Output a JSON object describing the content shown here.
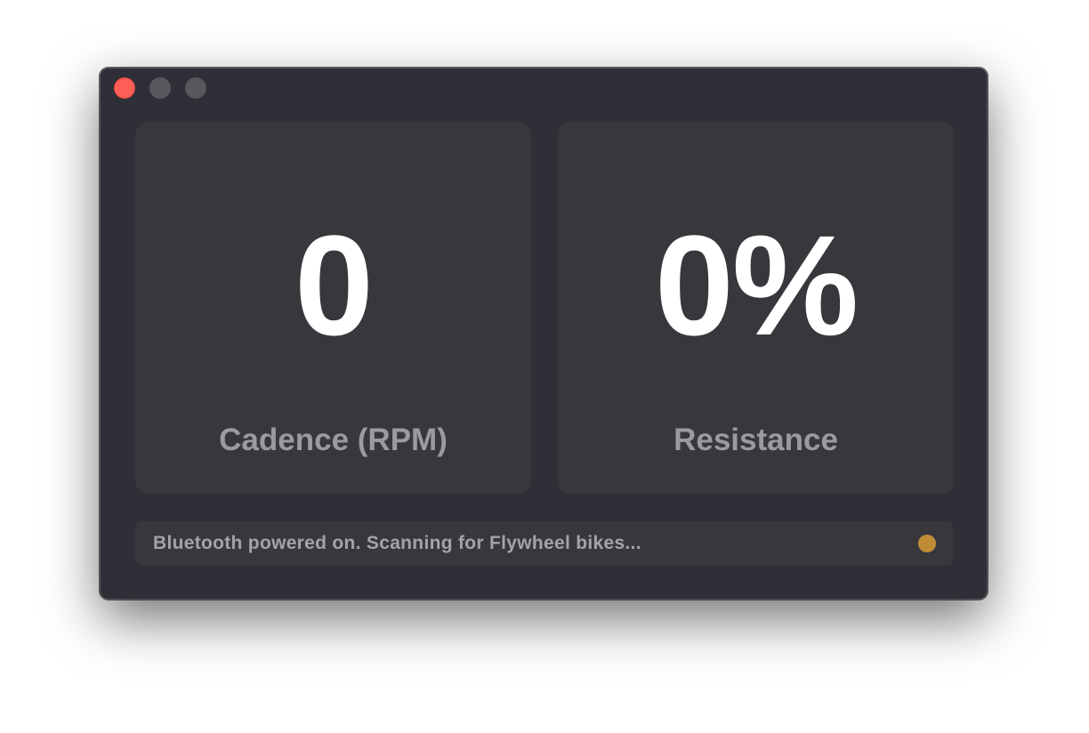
{
  "window": {
    "controls": {
      "close": "close-icon",
      "minimize": "minimize-icon",
      "zoom": "zoom-icon"
    }
  },
  "metrics": {
    "cadence": {
      "value": "0",
      "label": "Cadence (RPM)"
    },
    "resistance": {
      "value": "0%",
      "label": "Resistance"
    }
  },
  "status": {
    "message": "Bluetooth powered on. Scanning for Flywheel bikes...",
    "indicator_icon": "status-dot-icon",
    "indicator_color": "#c08c38"
  },
  "colors": {
    "window_background": "#2f2f37",
    "card_background": "#37373c",
    "value_text": "#ffffff",
    "label_text": "#9a9a9f",
    "close_button": "#fe5f57",
    "inactive_button": "#57575d"
  }
}
